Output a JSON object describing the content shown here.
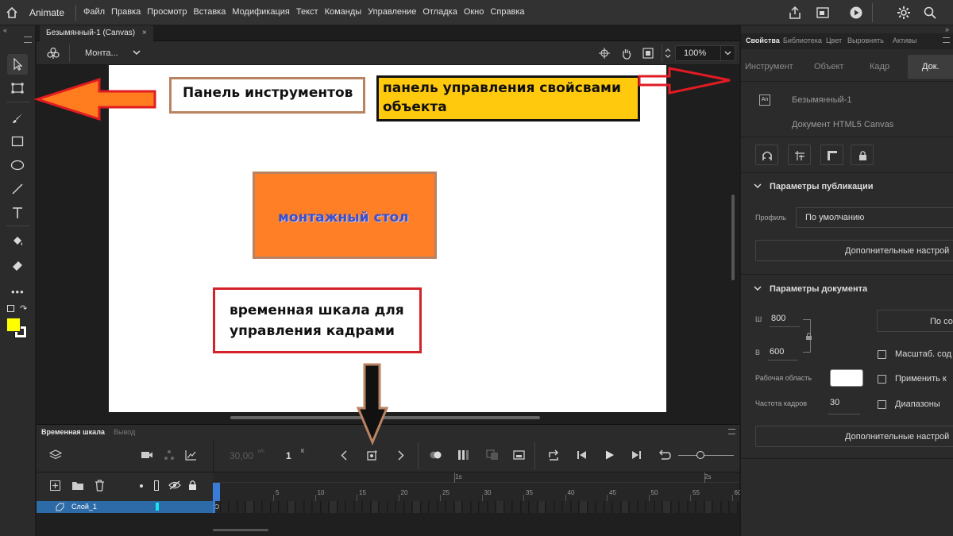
{
  "app": {
    "name": "Animate"
  },
  "menu": [
    "Файл",
    "Правка",
    "Просмотр",
    "Вставка",
    "Модификация",
    "Текст",
    "Команды",
    "Управление",
    "Отладка",
    "Окно",
    "Справка"
  ],
  "document_tab": {
    "title": "Безымянный-1 (Canvas)",
    "close": "×"
  },
  "doc_toolbar": {
    "scene": "Монта...",
    "zoom": "100%"
  },
  "stage": {
    "annotations": {
      "tools_panel": "Панель инструментов",
      "props_panel": "панель управления свойсвами объекта",
      "stage_label": "монтажный стол",
      "timeline_label": "временная шкала для управления кадрами"
    }
  },
  "timeline": {
    "tabs": [
      "Временная шкала",
      "Вывод"
    ],
    "fps": "30,00",
    "fps_unit": "к/с",
    "frame": "1",
    "frame_unit": "К",
    "ruler_seconds": [
      "1s",
      "2s"
    ],
    "ruler_numbers": [
      "5",
      "10",
      "15",
      "20",
      "25",
      "30",
      "35",
      "40",
      "45",
      "50",
      "55",
      "60"
    ],
    "layer": {
      "name": "Слой_1"
    }
  },
  "properties": {
    "tabs": [
      "Свойства",
      "Библиотека",
      "Цвет",
      "Выровнять",
      "Активы"
    ],
    "subtabs": [
      "Инструмент",
      "Объект",
      "Кадр",
      "Док."
    ],
    "doc_name": "Безымянный-1",
    "doc_type": "Документ HTML5 Canvas",
    "doc_icon": "An",
    "publish_section": "Параметры публикации",
    "profile_label": "Профиль",
    "profile_value": "По умолчанию",
    "more_settings": "Дополнительные настрой",
    "doc_section": "Параметры документа",
    "w_label": "Ш",
    "w_value": "800",
    "h_label": "В",
    "h_value": "600",
    "scale_btn": "По со",
    "stage_area_label": "Рабочая область",
    "scale_chk": "Масштаб. сод",
    "apply_chk": "Применить к",
    "fps_label": "Частота кадров",
    "fps_value": "30",
    "ranges_chk": "Диапазоны",
    "more_settings2": "Дополнительные настрой"
  },
  "colors": {
    "accent": "#2d6aa8",
    "stage_rect": "#fe7f26",
    "annotation_yellow": "#ffc90e",
    "fill_swatch": "#ffff00",
    "red_arrow": "#e11b22",
    "orange_arrow": "#ff7d1e"
  }
}
